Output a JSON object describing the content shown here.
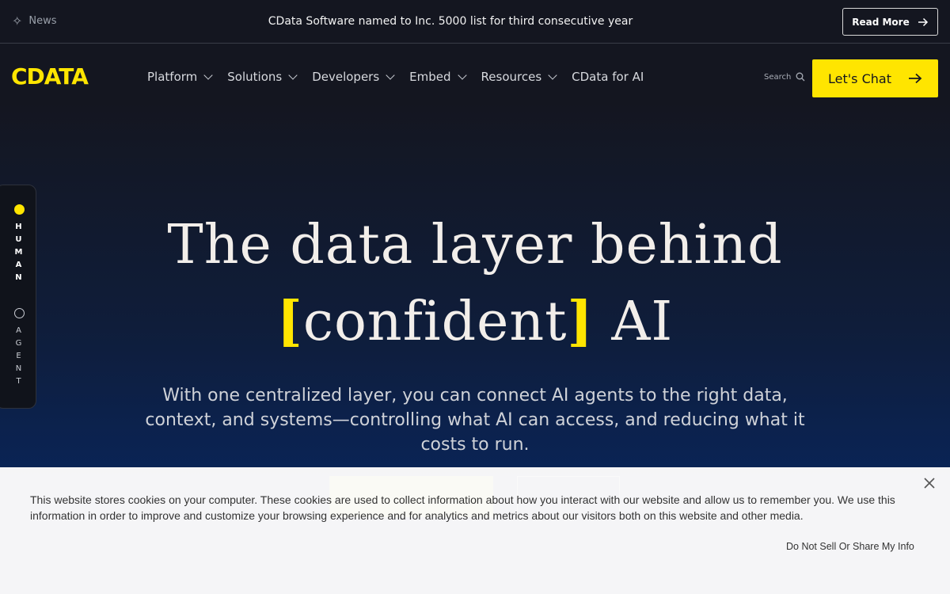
{
  "news_bar": {
    "tag_label": "News",
    "headline": "CData Software named to Inc. 5000 list for third consecutive year",
    "read_more_label": "Read More"
  },
  "nav": {
    "logo_text": "CDATA",
    "menu": [
      {
        "label": "Platform",
        "has_dropdown": true
      },
      {
        "label": "Solutions",
        "has_dropdown": true
      },
      {
        "label": "Developers",
        "has_dropdown": true
      },
      {
        "label": "Embed",
        "has_dropdown": true
      },
      {
        "label": "Resources",
        "has_dropdown": true
      },
      {
        "label": "CData for AI",
        "has_dropdown": false
      }
    ],
    "search_label": "Search",
    "cta_label": "Let's Chat"
  },
  "mode_toggle": {
    "human_label": "HUMAN",
    "agent_label": "AGENT",
    "selected": "HUMAN"
  },
  "hero": {
    "title_line1": "The data layer behind",
    "title_highlight": "confident",
    "title_end": "AI",
    "subtitle": "With one centralized layer, you can connect AI agents to the right data, context, and systems—controlling what AI can access, and reducing what it costs to run."
  },
  "cookie_banner": {
    "text": "This website stores cookies on your computer. These cookies are used to collect information about how you interact with our website and allow us to remember you. We use this information in order to improve and customize your browsing experience and for analytics and metrics about our visitors both on this website and other media.",
    "opt_out_label": "Do Not Sell Or Share My Info"
  },
  "colors": {
    "accent": "#ffe500",
    "bar_bg": "#141620",
    "hero_bottom": "#0a2a63",
    "banner_bg": "#fafafa"
  }
}
